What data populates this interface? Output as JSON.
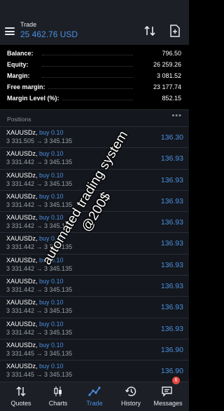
{
  "header": {
    "title": "Trade",
    "balance": "25 462.76 USD"
  },
  "summary": [
    {
      "label": "Balance:",
      "value": "796.50"
    },
    {
      "label": "Equity:",
      "value": "26 259.26"
    },
    {
      "label": "Margin:",
      "value": "3 081.52"
    },
    {
      "label": "Free margin:",
      "value": "23 177.74"
    },
    {
      "label": "Margin Level (%):",
      "value": "852.15"
    }
  ],
  "positions": {
    "title": "Positions",
    "more": "•••",
    "items": [
      {
        "symbol": "XAUUSDz,",
        "type": "buy 0.10",
        "prices": "3 331.505 → 3 345.135",
        "profit": "136.30"
      },
      {
        "symbol": "XAUUSDz,",
        "type": "buy 0.10",
        "prices": "3 331.442 → 3 345.135",
        "profit": "136.93"
      },
      {
        "symbol": "XAUUSDz,",
        "type": "buy 0.10",
        "prices": "3 331.442 → 3 345.135",
        "profit": "136.93"
      },
      {
        "symbol": "XAUUSDz,",
        "type": "buy 0.10",
        "prices": "3 331.442 → 3 345.135",
        "profit": "136.93"
      },
      {
        "symbol": "XAUUSDz,",
        "type": "buy 0.10",
        "prices": "3 331.442 → 3 345.135",
        "profit": "136.93"
      },
      {
        "symbol": "XAUUSDz,",
        "type": "buy 0.10",
        "prices": "3 331.442 → 3 345.135",
        "profit": "136.93"
      },
      {
        "symbol": "XAUUSDz,",
        "type": "buy 0.10",
        "prices": "3 331.442 → 3 345.135",
        "profit": "136.93"
      },
      {
        "symbol": "XAUUSDz,",
        "type": "buy 0.10",
        "prices": "3 331.442 → 3 345.135",
        "profit": "136.93"
      },
      {
        "symbol": "XAUUSDz,",
        "type": "buy 0.10",
        "prices": "3 331.442 → 3 345.135",
        "profit": "136.93"
      },
      {
        "symbol": "XAUUSDz,",
        "type": "buy 0.10",
        "prices": "3 331.442 → 3 345.135",
        "profit": "136.93"
      },
      {
        "symbol": "XAUUSDz,",
        "type": "buy 0.10",
        "prices": "3 331.445 → 3 345.135",
        "profit": "136.90"
      },
      {
        "symbol": "XAUUSDz,",
        "type": "buy 0.10",
        "prices": "3 331.445 → 3 345.135",
        "profit": "136.90"
      }
    ]
  },
  "watermark": {
    "line1": "automated trading system",
    "line2": "@200$"
  },
  "tabs": [
    {
      "label": "Quotes",
      "icon": "quotes-arrows-icon",
      "active": false
    },
    {
      "label": "Charts",
      "icon": "candlestick-chart-icon",
      "active": false
    },
    {
      "label": "Trade",
      "icon": "trade-trend-icon",
      "active": true
    },
    {
      "label": "History",
      "icon": "history-clock-icon",
      "active": false
    },
    {
      "label": "Messages",
      "icon": "messages-chat-icon",
      "active": false
    }
  ],
  "messages_badge": "6",
  "colors": {
    "accent": "#4a90e2",
    "header_bg": "#1c1f26",
    "list_bg": "#14171d",
    "badge": "#e5473f"
  }
}
